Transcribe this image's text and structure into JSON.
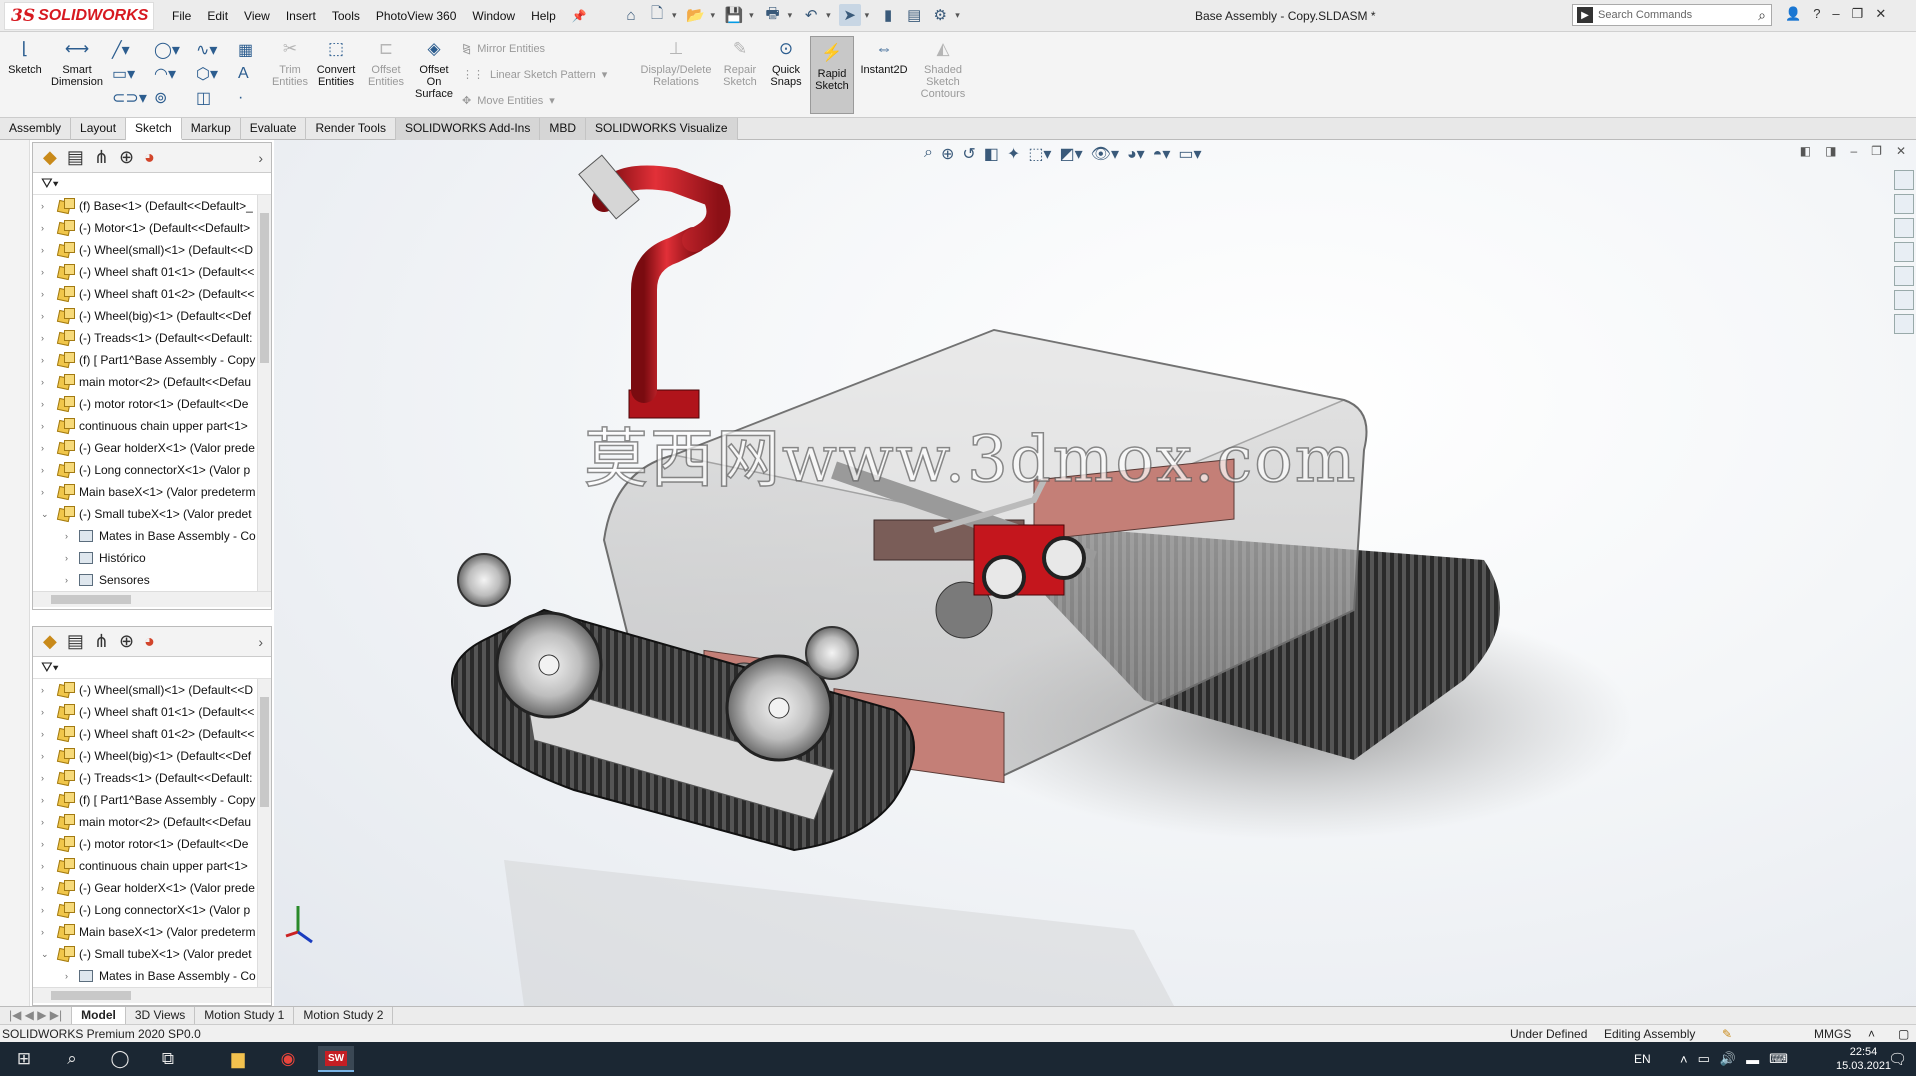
{
  "app": {
    "logo_ds": "3S",
    "logo_name": "SOLIDWORKS",
    "document_title": "Base Assembly - Copy.SLDASM *"
  },
  "menu": [
    "File",
    "Edit",
    "View",
    "Insert",
    "Tools",
    "PhotoView 360",
    "Window",
    "Help"
  ],
  "search": {
    "placeholder": "Search Commands"
  },
  "ribbon": {
    "sketch": "Sketch",
    "smart_dimension": "Smart Dimension",
    "trim_entities": "Trim Entities",
    "convert_entities": "Convert Entities",
    "offset_entities": "Offset Entities",
    "offset_on_surface": "Offset On Surface",
    "mirror_entities": "Mirror Entities",
    "linear_sketch_pattern": "Linear Sketch Pattern",
    "move_entities": "Move Entities",
    "display_delete_relations": "Display/Delete Relations",
    "repair_sketch": "Repair Sketch",
    "quick_snaps": "Quick Snaps",
    "rapid_sketch": "Rapid Sketch",
    "instant2d": "Instant2D",
    "shaded_sketch_contours": "Shaded Sketch Contours"
  },
  "tabs": [
    "Assembly",
    "Layout",
    "Sketch",
    "Markup",
    "Evaluate",
    "Render Tools",
    "SOLIDWORKS Add-Ins",
    "MBD",
    "SOLIDWORKS Visualize"
  ],
  "tree_top": [
    {
      "label": "(f) Base<1> (Default<<Default>_"
    },
    {
      "label": "(-) Motor<1> (Default<<Default>"
    },
    {
      "label": "(-) Wheel(small)<1> (Default<<D"
    },
    {
      "label": "(-) Wheel shaft 01<1> (Default<<"
    },
    {
      "label": "(-) Wheel shaft 01<2> (Default<<"
    },
    {
      "label": "(-) Wheel(big)<1> (Default<<Def"
    },
    {
      "label": "(-) Treads<1> (Default<<Default:"
    },
    {
      "label": "(f) [ Part1^Base Assembly - Copy"
    },
    {
      "label": "main motor<2> (Default<<Defau"
    },
    {
      "label": "(-) motor rotor<1> (Default<<De"
    },
    {
      "label": "continuous chain upper part<1>"
    },
    {
      "label": "(-) Gear holderX<1> (Valor prede"
    },
    {
      "label": "(-) Long connectorX<1> (Valor p"
    },
    {
      "label": "Main baseX<1> (Valor predeterm"
    },
    {
      "label": "(-) Small tubeX<1> (Valor predet"
    }
  ],
  "tree_top_sub": [
    "Mates in Base Assembly - Co",
    "Histórico",
    "Sensores"
  ],
  "tree_bottom": [
    {
      "label": "(-) Wheel(small)<1> (Default<<D"
    },
    {
      "label": "(-) Wheel shaft 01<1> (Default<<"
    },
    {
      "label": "(-) Wheel shaft 01<2> (Default<<"
    },
    {
      "label": "(-) Wheel(big)<1> (Default<<Def"
    },
    {
      "label": "(-) Treads<1> (Default<<Default:"
    },
    {
      "label": "(f) [ Part1^Base Assembly - Copy"
    },
    {
      "label": "main motor<2> (Default<<Defau"
    },
    {
      "label": "(-) motor rotor<1> (Default<<De"
    },
    {
      "label": "continuous chain upper part<1>"
    },
    {
      "label": "(-) Gear holderX<1> (Valor prede"
    },
    {
      "label": "(-) Long connectorX<1> (Valor p"
    },
    {
      "label": "Main baseX<1> (Valor predeterm"
    },
    {
      "label": "(-) Small tubeX<1> (Valor predet"
    }
  ],
  "tree_bottom_sub": [
    "Mates in Base Assembly - Co"
  ],
  "viewport": {
    "watermark": "莫西网www.3dmox.com"
  },
  "bottom_tabs": [
    "Model",
    "3D Views",
    "Motion Study 1",
    "Motion Study 2"
  ],
  "status": {
    "product": "SOLIDWORKS Premium 2020 SP0.0",
    "defined": "Under Defined",
    "mode": "Editing Assembly",
    "units": "MMGS"
  },
  "taskbar": {
    "language": "EN",
    "time": "22:54",
    "date": "15.03.2021",
    "sw_badge": "SW"
  }
}
